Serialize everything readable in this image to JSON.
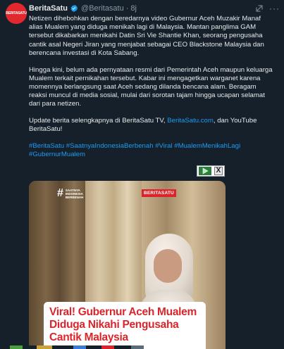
{
  "tweet": {
    "avatar_text": "BERITASATU",
    "author_name": "BeritaSatu",
    "handle": "@Beritasatu",
    "dot": "·",
    "time": "8j",
    "more_label": "···",
    "paragraphs": [
      "Netizen dihebohkan dengan beredarnya video Gubernur Aceh Muzakir Manaf alias Mualem yang diduga menikah lagi di Malaysia. Mantan panglima GAM tersebut dikabarkan menikahi Datin Sri Vie Shantie Khan, seorang pengusaha cantik asal Negeri Jiran yang menjabat sebagai CEO Blackstone Malaysia dan berencana investasi di Kota Sabang.",
      "Hingga kini, belum ada pernyataan resmi dari Pemerintah Aceh maupun keluarga Mualem terkait pernikahan tersebut. Kabar ini mengagetkan warganet karena momennya berlangsung saat Aceh sedang dilanda bencana alam. Beragam reaksi muncul di media sosial, mulai dari sorotan tajam hingga ucapan selamat dari para netizen."
    ],
    "update_prefix": "Update berita selengkapnya di BeritaSatu TV, ",
    "update_link": "BeritaSatu.com",
    "update_suffix": ", dan YouTube BeritaSatu!",
    "hashtags": "#BeritaSatu #SaatnyaIndonesiaBerbenah #Viral #MualemMenikahLagi #GubernurMualem"
  },
  "translate_widget": {
    "close_label": "X"
  },
  "media": {
    "logo_hash": "#",
    "logo_text": [
      "SAATNYA",
      "INDONESIA",
      "BERBENAH"
    ],
    "brand": "BERITASATU",
    "caption": [
      "Viral! Gubernur Aceh Mualem",
      "Diduga Nikahi Pengusaha",
      "Cantik Malaysia"
    ]
  },
  "colors": {
    "background": "#15202b",
    "text": "#e7e9ea",
    "muted": "#8b98a5",
    "link": "#1d9bf0",
    "brand_red": "#d9252b"
  },
  "icons": [
    "verified-badge-icon",
    "grok-icon",
    "more-icon",
    "play-icon",
    "close-icon"
  ]
}
